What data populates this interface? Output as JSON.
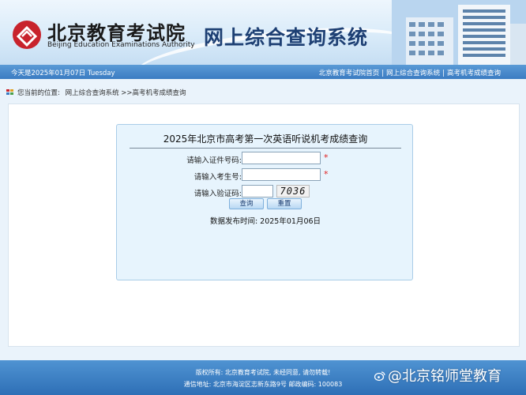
{
  "header": {
    "org_cn": "北京教育考试院",
    "org_en": "Beijing Education Examinations Authority",
    "system_title": "网上综合查询系统"
  },
  "navbar": {
    "date": "今天是2025年01月07日  Tuesday",
    "links": [
      "北京教育考试院首页",
      "网上综合查询系统",
      "高考机考成绩查询"
    ],
    "separator": "|"
  },
  "breadcrumb": {
    "prefix": "您当前的位置:",
    "path": "网上综合查询系统 >>高考机考成绩查询"
  },
  "query": {
    "title": "2025年北京市高考第一次英语听说机考成绩查询",
    "id_label": "请输入证件号码:",
    "id_value": "",
    "exam_label": "请输入考生号:",
    "exam_value": "",
    "captcha_label": "请输入验证码:",
    "captcha_value": "",
    "captcha_text": "7036",
    "required_mark": "*",
    "query_button": "查询",
    "reset_button": "重置",
    "publish_time": "数据发布时间: 2025年01月06日"
  },
  "footer": {
    "line1": "版权所有: 北京教育考试院, 未经同意, 请勿转载!",
    "line2": "通信地址: 北京市海淀区志新东路9号 邮政编码: 100083"
  },
  "watermark": {
    "text": "@北京铭师堂教育"
  },
  "colors": {
    "nav_blue": "#3b7cc2",
    "title_blue": "#1d3f73",
    "logo_red": "#c8232c",
    "required_red": "#e02020",
    "panel_bg": "#e7f4fd"
  }
}
